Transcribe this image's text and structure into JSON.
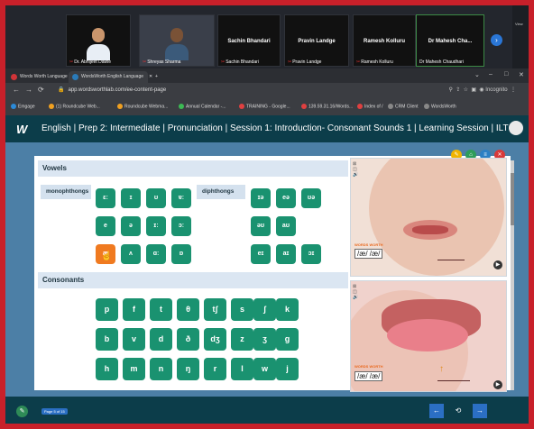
{
  "meeting": {
    "participants": [
      {
        "name": "Dr. Abhijeet Dawle"
      },
      {
        "name": "Shreyas Sharma"
      },
      {
        "name": "Sachin Bhandari",
        "center": "Sachin Bhandari"
      },
      {
        "name": "Pravin Landge",
        "center": "Pravin Landge"
      },
      {
        "name": "Ramesh Kolluru",
        "center": "Ramesh Kolluru"
      },
      {
        "name": "Dr Mahesh Chaudhari",
        "center": "Dr Mahesh Cha..."
      }
    ],
    "right_label": "View"
  },
  "browser": {
    "tabs": [
      {
        "label": "Words Worth Language Lab"
      },
      {
        "label": "WordsWorth English Language"
      }
    ],
    "new_tab": "+",
    "url": "app.wordsworthlab.com/ee-content-page",
    "incognito": "Incognito",
    "bookmarks": [
      {
        "label": "Emgage",
        "color": "#2b8ad8"
      },
      {
        "label": "(1) Roundcube Web...",
        "color": "#f0a020"
      },
      {
        "label": "Roundcube Webma...",
        "color": "#f0a020"
      },
      {
        "label": "Annual Calendar -...",
        "color": "#3cba54"
      },
      {
        "label": "TRAINING - Google...",
        "color": "#e04040"
      },
      {
        "label": "139.59.31.16/Words...",
        "color": "#e04040"
      },
      {
        "label": "Index of /",
        "color": "#e04040"
      },
      {
        "label": "CRM Client",
        "color": "#888888"
      },
      {
        "label": "WordsWorth",
        "color": "#888888"
      }
    ]
  },
  "app": {
    "logo": "W",
    "title": "English | Prep 2: Intermediate | Pronunciation | Session 1: Introduction- Consonant Sounds 1 | Learning Session | ILT",
    "sections": {
      "vowels": "Vowels",
      "consonants": "Consonants"
    },
    "categories": {
      "monophthongs": "monophthongs",
      "diphthongs": "diphthongs"
    },
    "monophthongs_rows": [
      [
        "ɛː",
        "ɪ",
        "ʊ",
        "ɐː"
      ],
      [
        "e",
        "ə",
        "ɪː",
        "ɔː"
      ],
      [
        "æ",
        "ʌ",
        "ɑː",
        "ɒ"
      ]
    ],
    "diphthongs_rows": [
      [
        "ɪə",
        "eə",
        "ʊə"
      ],
      [
        "əʊ",
        "aʊ"
      ],
      [
        "eɪ",
        "aɪ",
        "ɔɪ"
      ]
    ],
    "consonant_rows": [
      [
        "p",
        "f",
        "t",
        "θ",
        "tʃ",
        "s",
        "ʃ",
        "k"
      ],
      [
        "b",
        "v",
        "d",
        "ð",
        "dʒ",
        "z",
        "ʒ",
        "g"
      ],
      [
        "h",
        "m",
        "n",
        "ŋ",
        "r",
        "l",
        "w",
        "j"
      ]
    ],
    "illustrations": [
      {
        "ipa": "/æ/ /æ/"
      },
      {
        "ipa": "/æ/ /æ/"
      }
    ],
    "footer": {
      "page": "Page 5 of 15",
      "prev": "←",
      "restore": "⟲",
      "next": "→"
    }
  }
}
